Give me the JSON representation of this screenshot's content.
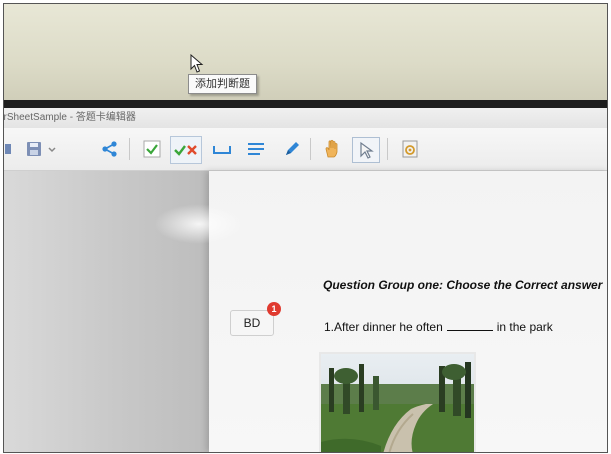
{
  "window": {
    "title": "erSheetSample - 答题卡编辑器"
  },
  "toolbar": {
    "items": [
      {
        "icon": "app-icon"
      },
      {
        "icon": "save-icon"
      },
      {
        "icon": "dropdown-arrow-icon"
      },
      {
        "icon": "share-icon"
      },
      {
        "icon": "checkbox-icon"
      },
      {
        "icon": "true-false-icon"
      },
      {
        "icon": "blank-line-icon"
      },
      {
        "icon": "text-lines-icon"
      },
      {
        "icon": "pen-icon"
      },
      {
        "icon": "hand-icon"
      },
      {
        "icon": "select-arrow-icon"
      },
      {
        "icon": "settings-doc-icon"
      }
    ],
    "tooltip": "添加判断题"
  },
  "document": {
    "group_heading": "Question Group one: Choose the Correct answer",
    "answer_box": {
      "label": "BD",
      "badge": "1"
    },
    "question": {
      "before": "1.After dinner he often",
      "after": "in the park"
    }
  },
  "colors": {
    "accent_blue": "#2f86d6",
    "check_green": "#3aa63a",
    "cross_red": "#e04b2c",
    "badge_red": "#e03a2f"
  }
}
